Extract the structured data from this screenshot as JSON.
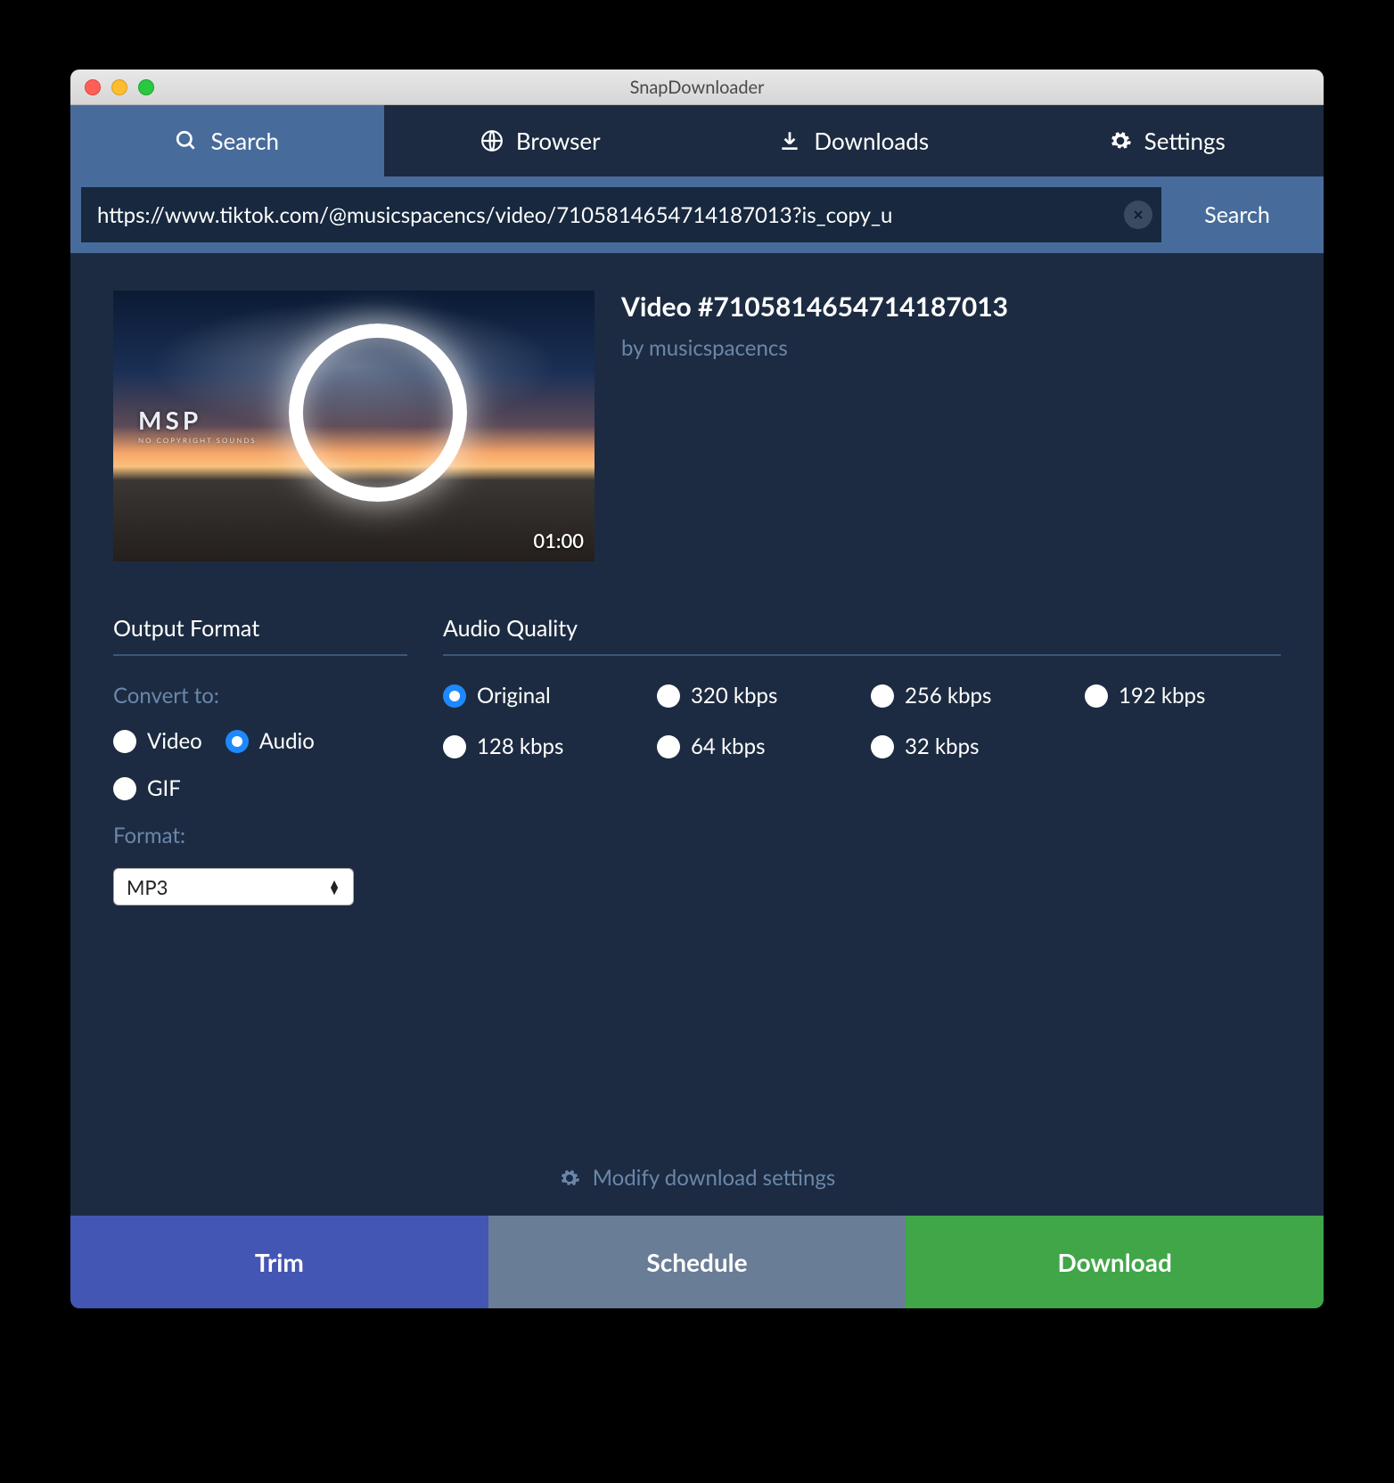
{
  "window": {
    "title": "SnapDownloader"
  },
  "tabs": {
    "search": "Search",
    "browser": "Browser",
    "downloads": "Downloads",
    "settings": "Settings",
    "active": "search"
  },
  "search": {
    "url": "https://www.tiktok.com/@musicspacencs/video/7105814654714187013?is_copy_u",
    "button": "Search"
  },
  "video": {
    "title": "Video #7105814654714187013",
    "author": "by musicspacencs",
    "duration": "01:00",
    "thumb_logo": "MSP",
    "thumb_logo_sub": "NO COPYRIGHT SOUNDS"
  },
  "output": {
    "section_label": "Output Format",
    "convert_label": "Convert to:",
    "types": {
      "video": "Video",
      "audio": "Audio",
      "gif": "GIF"
    },
    "selected_type": "audio",
    "format_label": "Format:",
    "format_value": "MP3"
  },
  "quality": {
    "section_label": "Audio Quality",
    "options": [
      "Original",
      "320 kbps",
      "256 kbps",
      "192 kbps",
      "128 kbps",
      "64 kbps",
      "32 kbps"
    ],
    "selected": "Original"
  },
  "modify_settings": "Modify download settings",
  "actions": {
    "trim": "Trim",
    "schedule": "Schedule",
    "download": "Download"
  }
}
